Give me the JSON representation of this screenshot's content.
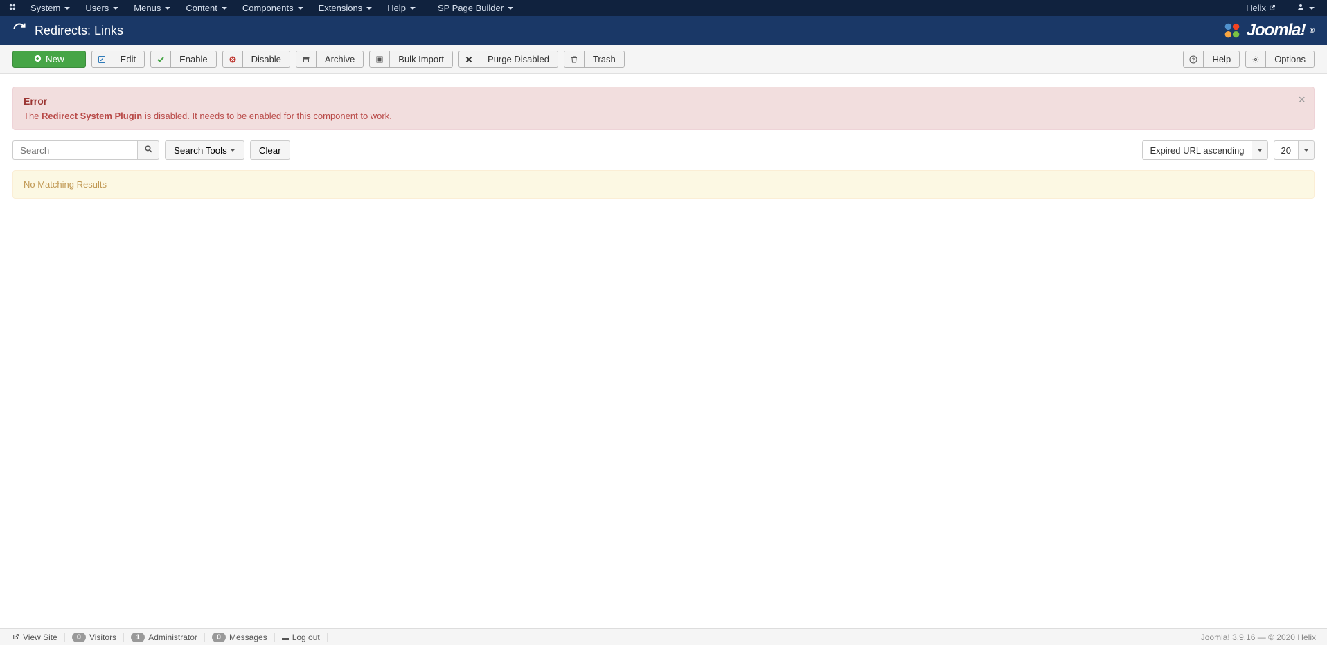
{
  "topnav": {
    "items": [
      "System",
      "Users",
      "Menus",
      "Content",
      "Components",
      "Extensions",
      "Help",
      "SP Page Builder"
    ],
    "site_name": "Helix"
  },
  "titlebar": {
    "title": "Redirects: Links",
    "brand": "Joomla!"
  },
  "toolbar": {
    "new": "New",
    "edit": "Edit",
    "enable": "Enable",
    "disable": "Disable",
    "archive": "Archive",
    "bulk_import": "Bulk Import",
    "purge_disabled": "Purge Disabled",
    "trash": "Trash",
    "help": "Help",
    "options": "Options"
  },
  "alert_error": {
    "heading": "Error",
    "prefix": "The ",
    "strong": "Redirect System Plugin",
    "suffix": " is disabled. It needs to be enabled for this component to work."
  },
  "search": {
    "placeholder": "Search",
    "search_tools": "Search Tools",
    "clear": "Clear",
    "sort_selected": "Expired URL ascending",
    "limit_selected": "20"
  },
  "results": {
    "no_match": "No Matching Results"
  },
  "statusbar": {
    "view_site": "View Site",
    "visitors_count": "0",
    "visitors_label": "Visitors",
    "admin_count": "1",
    "admin_label": "Administrator",
    "messages_count": "0",
    "messages_label": "Messages",
    "logout": "Log out",
    "version": "Joomla! 3.9.16",
    "separator": " — ",
    "copyright": "© 2020 Helix"
  }
}
